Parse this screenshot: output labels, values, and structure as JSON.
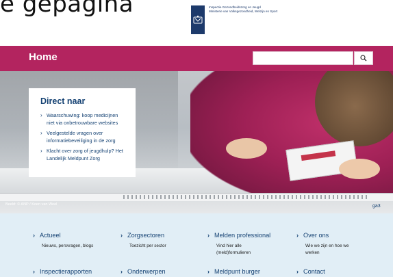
{
  "crop_heading": "e gepagina",
  "logo": {
    "line1": "Inspectie Gezondheidszorg en Jeugd",
    "line2": "Ministerie van Volksgezondheid, Welzijn en Sport",
    "icon": "rijkswapen-icon"
  },
  "header": {
    "title": "Home",
    "search_placeholder": "",
    "search_icon": "search-icon",
    "brand_color": "#b3245f"
  },
  "hero": {
    "credit": "Beeld: © ANP / Koen van Weel",
    "badge": "ga3"
  },
  "direct_naar": {
    "heading": "Direct naar",
    "links": [
      "Waarschuwing: koop medicijnen niet via onbetrouwbare websites",
      "Veelgestelde vragen over informatiebeveiliging in de zorg",
      "Klacht over zorg of jeugdhulp? Het Landelijk Meldpunt Zorg"
    ]
  },
  "nav_columns": [
    {
      "title": "Actueel",
      "desc": "Nieuws, persvragen, blogs"
    },
    {
      "title": "Zorgsectoren",
      "desc": "Toezicht per sector"
    },
    {
      "title": "Melden professional",
      "desc": "Vind hier alle (meld)formulieren"
    },
    {
      "title": "Over ons",
      "desc": "Wie we zijn en hoe we werken"
    }
  ],
  "nav_row2": [
    {
      "title": "Inspectierapporten"
    },
    {
      "title": "Onderwerpen"
    },
    {
      "title": "Meldpunt burger"
    },
    {
      "title": "Contact"
    }
  ]
}
